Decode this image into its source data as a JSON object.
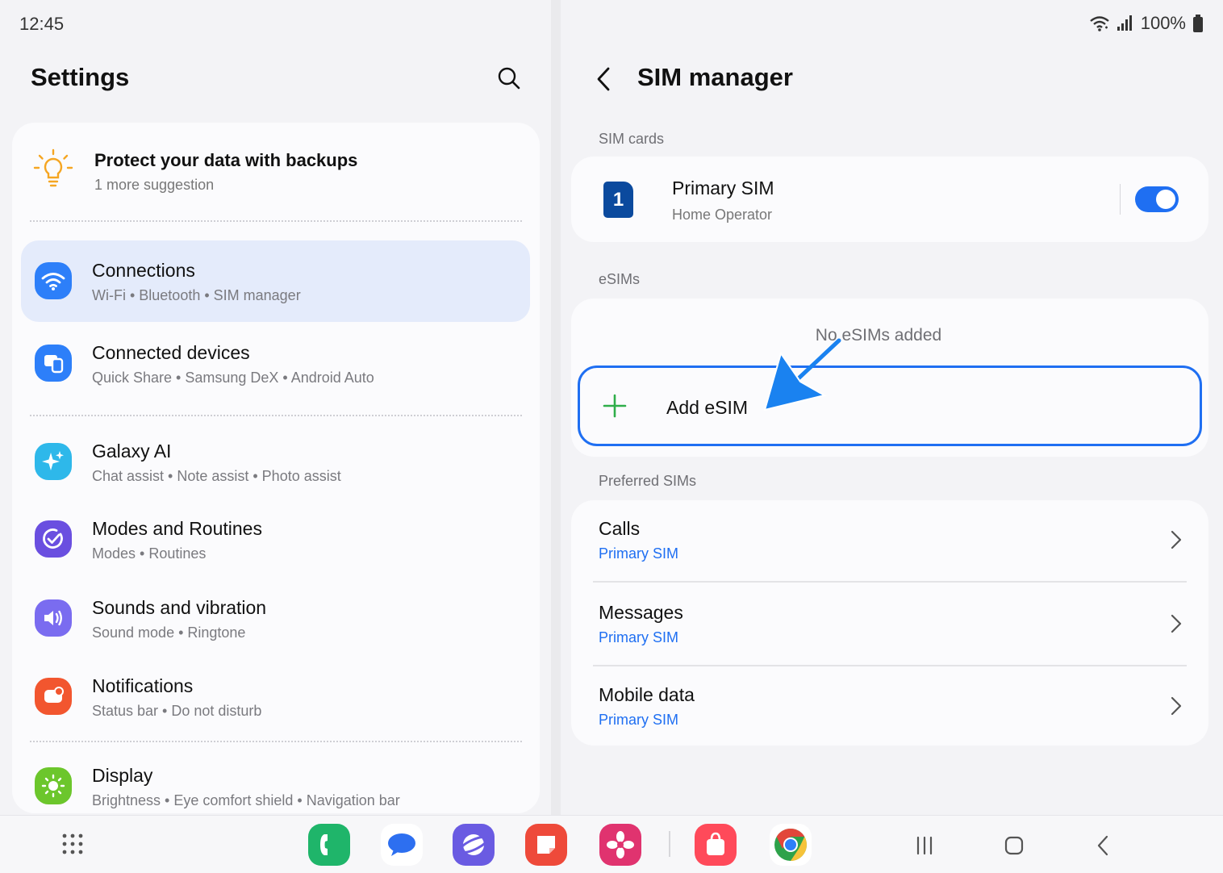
{
  "status_bar": {
    "time": "12:45",
    "battery": "100%",
    "icons": [
      "wifi-icon",
      "signal-icon",
      "battery-icon"
    ]
  },
  "settings": {
    "title": "Settings",
    "search_icon": "search-icon",
    "suggestion": {
      "title": "Protect your data with backups",
      "subtitle": "1 more suggestion",
      "icon": "lightbulb-icon"
    },
    "items": [
      {
        "title": "Connections",
        "subtitle": "Wi-Fi  •  Bluetooth  •  SIM manager",
        "icon": "wifi-icon",
        "color": "#2d7ff9",
        "active": true
      },
      {
        "title": "Connected devices",
        "subtitle": "Quick Share  •  Samsung DeX  •  Android Auto",
        "icon": "devices-icon",
        "color": "#2d7ff9",
        "active": false
      },
      {
        "title": "Galaxy AI",
        "subtitle": "Chat assist  •  Note assist  •  Photo assist",
        "icon": "sparkle-icon",
        "color": "#2eb8ea",
        "active": false
      },
      {
        "title": "Modes and Routines",
        "subtitle": "Modes  •  Routines",
        "icon": "check-circle-icon",
        "color": "#6a4fe0",
        "active": false
      },
      {
        "title": "Sounds and vibration",
        "subtitle": "Sound mode  •  Ringtone",
        "icon": "speaker-icon",
        "color": "#7a6cf0",
        "active": false
      },
      {
        "title": "Notifications",
        "subtitle": "Status bar  •  Do not disturb",
        "icon": "notification-icon",
        "color": "#f2562f",
        "active": false
      },
      {
        "title": "Display",
        "subtitle": "Brightness  •  Eye comfort shield  •  Navigation bar",
        "icon": "sun-icon",
        "color": "#6cc62c",
        "active": false
      }
    ]
  },
  "sim_manager": {
    "title": "SIM manager",
    "back_icon": "chevron-left-icon",
    "sim_cards_label": "SIM cards",
    "primary_sim": {
      "badge": "1",
      "name": "Primary SIM",
      "operator": "Home Operator",
      "enabled": true
    },
    "esims_label": "eSIMs",
    "no_esims": "No eSIMs added",
    "add_esim": "Add eSIM",
    "preferred_label": "Preferred SIMs",
    "preferred": [
      {
        "title": "Calls",
        "value": "Primary SIM"
      },
      {
        "title": "Messages",
        "value": "Primary SIM"
      },
      {
        "title": "Mobile data",
        "value": "Primary SIM"
      }
    ]
  },
  "dock": {
    "apps": [
      {
        "name": "phone",
        "color": "#1fb56a"
      },
      {
        "name": "messages",
        "color": "#ffffff"
      },
      {
        "name": "internet",
        "color": "#6a5be2"
      },
      {
        "name": "notes",
        "color": "#ee4a3a"
      },
      {
        "name": "gallery",
        "color": "#e0336f"
      },
      {
        "name": "galaxy-store",
        "color": "#ff4a5a"
      },
      {
        "name": "chrome",
        "color": "#ffffff"
      }
    ]
  },
  "colors": {
    "accent": "#1f6ff2",
    "active_row": "#e4ebfb",
    "arrow": "#1a82f0"
  }
}
